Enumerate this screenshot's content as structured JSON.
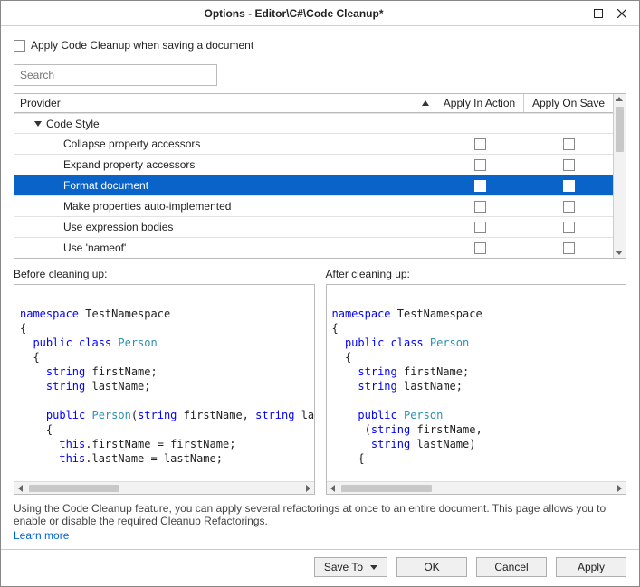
{
  "titlebar": {
    "title": "Options - Editor\\C#\\Code Cleanup*"
  },
  "options": {
    "applyOnSaveLabel": "Apply Code Cleanup when saving a document",
    "searchPlaceholder": "Search"
  },
  "columns": {
    "provider": "Provider",
    "applyInAction": "Apply In Action",
    "applyOnSave": "Apply On Save"
  },
  "groupLabel": "Code Style",
  "rows": [
    {
      "label": "Collapse property accessors",
      "selected": false
    },
    {
      "label": "Expand property accessors",
      "selected": false
    },
    {
      "label": "Format document",
      "selected": true
    },
    {
      "label": "Make properties auto-implemented",
      "selected": false
    },
    {
      "label": "Use expression bodies",
      "selected": false
    },
    {
      "label": "Use 'nameof'",
      "selected": false
    }
  ],
  "preview": {
    "beforeTitle": "Before cleaning up:",
    "afterTitle": "After cleaning up:"
  },
  "codeBefore": {
    "l1a": "namespace",
    "l1b": " TestNamespace",
    "l2": "{",
    "l3a": "  public",
    "l3b": " class",
    "l3c": " Person",
    "l4": "  {",
    "l5a": "    string",
    "l5b": " firstName;",
    "l6a": "    string",
    "l6b": " lastName;",
    "l7": "",
    "l8a": "    public",
    "l8b": " Person",
    "l8c": "(",
    "l8d": "string",
    "l8e": " firstName, ",
    "l8f": "string",
    "l8g": " la",
    "l9": "    {",
    "l10a": "      this",
    "l10b": ".firstName = firstName;",
    "l11a": "      this",
    "l11b": ".lastName = lastName;"
  },
  "codeAfter": {
    "l1a": "namespace",
    "l1b": " TestNamespace",
    "l2": "{",
    "l3a": "  public",
    "l3b": " class",
    "l3c": " Person",
    "l4": "  {",
    "l5a": "    string",
    "l5b": " firstName;",
    "l6a": "    string",
    "l6b": " lastName;",
    "l7": "",
    "l8a": "    public",
    "l8b": " Person",
    "l9a": "     (",
    "l9b": "string",
    "l9c": " firstName,",
    "l10a": "      ",
    "l10b": "string",
    "l10c": " lastName)",
    "l11": "    {"
  },
  "description": "Using the Code Cleanup feature, you can apply several refactorings at once to an entire document. This page allows you to enable or disable the required Cleanup Refactorings.",
  "learnMore": "Learn more",
  "buttons": {
    "saveTo": "Save To",
    "ok": "OK",
    "cancel": "Cancel",
    "apply": "Apply"
  }
}
